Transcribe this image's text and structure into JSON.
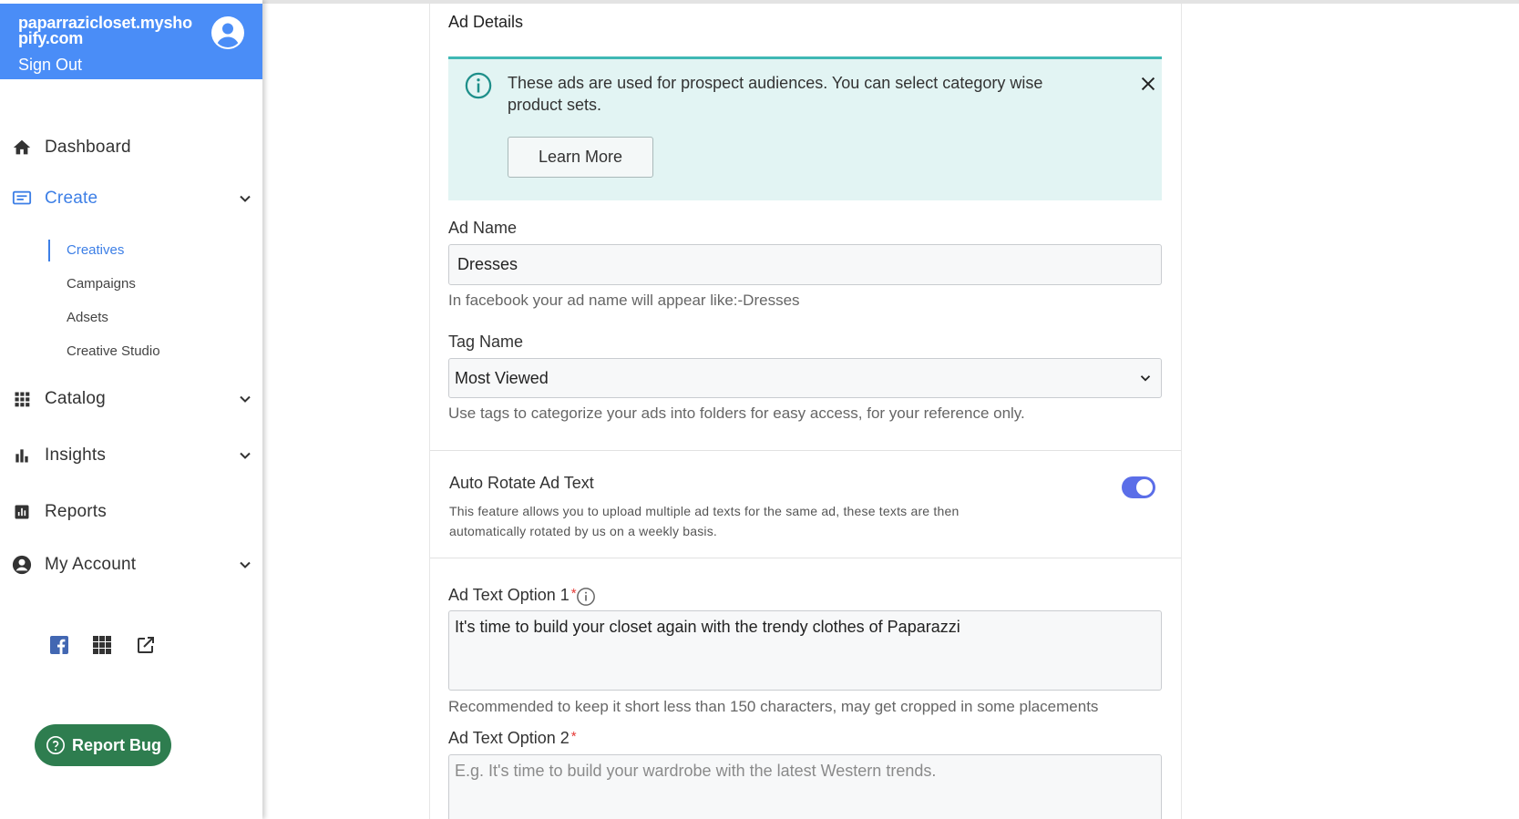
{
  "sidebar": {
    "shop_name": "paparrazicloset.myshopify.com",
    "sign_out": "Sign Out",
    "nav": {
      "dashboard": "Dashboard",
      "create": "Create",
      "catalog": "Catalog",
      "insights": "Insights",
      "reports": "Reports",
      "my_account": "My Account"
    },
    "create_items": [
      "Creatives",
      "Campaigns",
      "Adsets",
      "Creative Studio"
    ],
    "report_bug": "Report Bug",
    "icons": {
      "facebook": "facebook-icon",
      "apps": "apps-grid-icon",
      "external": "open-external-icon"
    }
  },
  "main": {
    "section_title": "Ad Details",
    "info_box": {
      "text": "These ads are used for prospect audiences. You can select category wise product sets.",
      "learn_more": "Learn More"
    },
    "ad_name": {
      "label": "Ad Name",
      "value": "Dresses",
      "help": "In facebook your ad name will appear like:-Dresses"
    },
    "tag_name": {
      "label": "Tag Name",
      "selected": "Most Viewed",
      "help": "Use tags to categorize your ads into folders for easy access, for your reference only."
    },
    "auto_rotate": {
      "title": "Auto Rotate Ad Text",
      "description": "This feature allows you to upload multiple ad texts for the same ad, these texts are then automatically rotated by us on a weekly basis.",
      "enabled": true
    },
    "ad_text_1": {
      "label": "Ad Text Option 1",
      "required_mark": "*",
      "value": "It's time to build your closet again with the trendy clothes of Paparazzi",
      "help": "Recommended to keep it short less than 150 characters, may get cropped in some placements"
    },
    "ad_text_2": {
      "label": "Ad Text Option 2",
      "required_mark": "*",
      "placeholder": "E.g. It's time to build your wardrobe with the latest Western trends."
    }
  },
  "colors": {
    "brand_blue": "#4a8df7",
    "active_blue": "#3d7fe6",
    "info_bg": "#e2f4f3",
    "info_border": "#3fb8b4",
    "toggle_on": "#5b6ee8",
    "report_bug_green": "#2e7d4f",
    "required_red": "#e53935"
  }
}
